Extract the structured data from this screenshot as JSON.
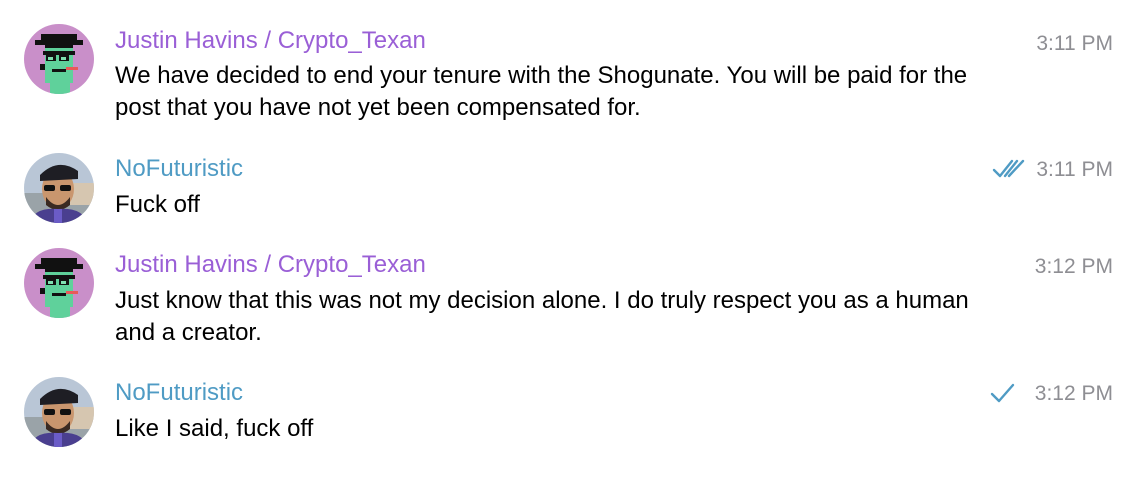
{
  "messages": [
    {
      "sender": "Justin Havins / Crypto_Texan",
      "text": "We have decided to end your tenure with the Shogunate. You will be paid for the post that you have not yet been compensated for.",
      "time": "3:11 PM",
      "avatar": "pixel-punk-avatar",
      "status": "none"
    },
    {
      "sender": "NoFuturistic",
      "text": "Fuck off",
      "time": "3:11 PM",
      "avatar": "user-photo-avatar",
      "status": "read"
    },
    {
      "sender": "Justin Havins / Crypto_Texan",
      "text": "Just know that this was not my decision alone. I do truly respect you as a human and a creator.",
      "time": "3:12 PM",
      "avatar": "pixel-punk-avatar",
      "status": "none"
    },
    {
      "sender": "NoFuturistic",
      "text": "Like I said, fuck off",
      "time": "3:12 PM",
      "avatar": "user-photo-avatar",
      "status": "sent"
    }
  ],
  "colors": {
    "sender_purple": "#9a5fd6",
    "sender_blue": "#4f9bc4",
    "timestamp": "#8e8e93",
    "check": "#4f9bc4"
  }
}
